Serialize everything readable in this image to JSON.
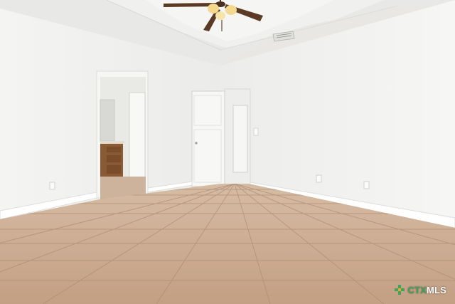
{
  "photo": {
    "scene": "empty-bedroom-interior",
    "colors": {
      "wall": "#f1f1ef",
      "ceiling": "#eaeae8",
      "floor_tile": "#c9a98e",
      "floor_grout": "#ad8c72",
      "baseboard": "#ffffff",
      "door": "#f7f7f5",
      "vanity_wood": "#8a5a34",
      "fan_blade": "#5a3a24",
      "fan_light": "#f3d88e"
    },
    "watermark": {
      "brand_prefix": "CTX",
      "brand_suffix": "MLS",
      "brand_color": "#3da55b",
      "icon": "mls-logo-icon"
    }
  }
}
